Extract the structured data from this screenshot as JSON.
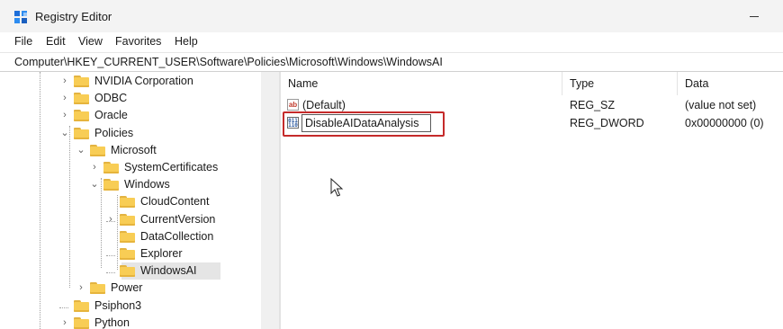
{
  "window": {
    "title": "Registry Editor"
  },
  "menu": [
    "File",
    "Edit",
    "View",
    "Favorites",
    "Help"
  ],
  "address": "Computer\\HKEY_CURRENT_USER\\Software\\Policies\\Microsoft\\Windows\\WindowsAI",
  "tree": [
    {
      "label": "NVIDIA Corporation",
      "expander": "›"
    },
    {
      "label": "ODBC",
      "expander": "›"
    },
    {
      "label": "Oracle",
      "expander": "›"
    },
    {
      "label": "Policies",
      "expander": "⌄"
    },
    {
      "label": "Microsoft",
      "expander": "⌄"
    },
    {
      "label": "SystemCertificates",
      "expander": "›"
    },
    {
      "label": "Windows",
      "expander": "⌄"
    },
    {
      "label": "CloudContent",
      "expander": ""
    },
    {
      "label": "CurrentVersion",
      "expander": "›"
    },
    {
      "label": "DataCollection",
      "expander": ""
    },
    {
      "label": "Explorer",
      "expander": ""
    },
    {
      "label": "WindowsAI",
      "expander": "",
      "selected": true
    },
    {
      "label": "Power",
      "expander": "›"
    },
    {
      "label": "Psiphon3",
      "expander": ""
    },
    {
      "label": "Python",
      "expander": "›"
    }
  ],
  "list": {
    "columns": [
      "Name",
      "Type",
      "Data"
    ],
    "rows": [
      {
        "icon": "ab",
        "name": "(Default)",
        "type": "REG_SZ",
        "data": "(value not set)"
      },
      {
        "icon": "bin",
        "name": "DisableAIDataAnalysis",
        "type": "REG_DWORD",
        "data": "0x00000000 (0)"
      }
    ],
    "icon_glyphs": {
      "ab": "ab",
      "bin": "011 110"
    }
  },
  "colors": {
    "highlight": "#c52a2a",
    "folder": "#f8cd55",
    "selected": "#e5e5e5"
  }
}
